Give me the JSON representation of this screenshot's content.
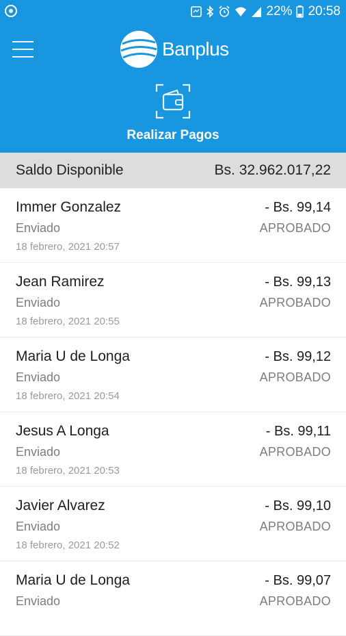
{
  "status_bar": {
    "battery": "22%",
    "time": "20:58"
  },
  "header": {
    "brand": "Banplus",
    "action_label": "Realizar Pagos"
  },
  "balance": {
    "label": "Saldo Disponible",
    "amount": "Bs. 32.962.017,22"
  },
  "transactions": [
    {
      "name": "Immer Gonzalez",
      "type": "Enviado",
      "date": "18 febrero, 2021 20:57",
      "amount": "- Bs. 99,14",
      "status": "APROBADO"
    },
    {
      "name": "Jean Ramirez",
      "type": "Enviado",
      "date": "18 febrero, 2021 20:55",
      "amount": "- Bs. 99,13",
      "status": "APROBADO"
    },
    {
      "name": "Maria U de Longa",
      "type": "Enviado",
      "date": "18 febrero, 2021 20:54",
      "amount": "- Bs. 99,12",
      "status": "APROBADO"
    },
    {
      "name": "Jesus A Longa",
      "type": "Enviado",
      "date": "18 febrero, 2021 20:53",
      "amount": "- Bs. 99,11",
      "status": "APROBADO"
    },
    {
      "name": "Javier Alvarez",
      "type": "Enviado",
      "date": "18 febrero, 2021 20:52",
      "amount": "- Bs. 99,10",
      "status": "APROBADO"
    },
    {
      "name": "Maria U de Longa",
      "type": "Enviado",
      "date": "",
      "amount": "- Bs. 99,07",
      "status": "APROBADO"
    }
  ],
  "colors": {
    "primary": "#1996e0",
    "balance_bg": "#dddddd"
  }
}
